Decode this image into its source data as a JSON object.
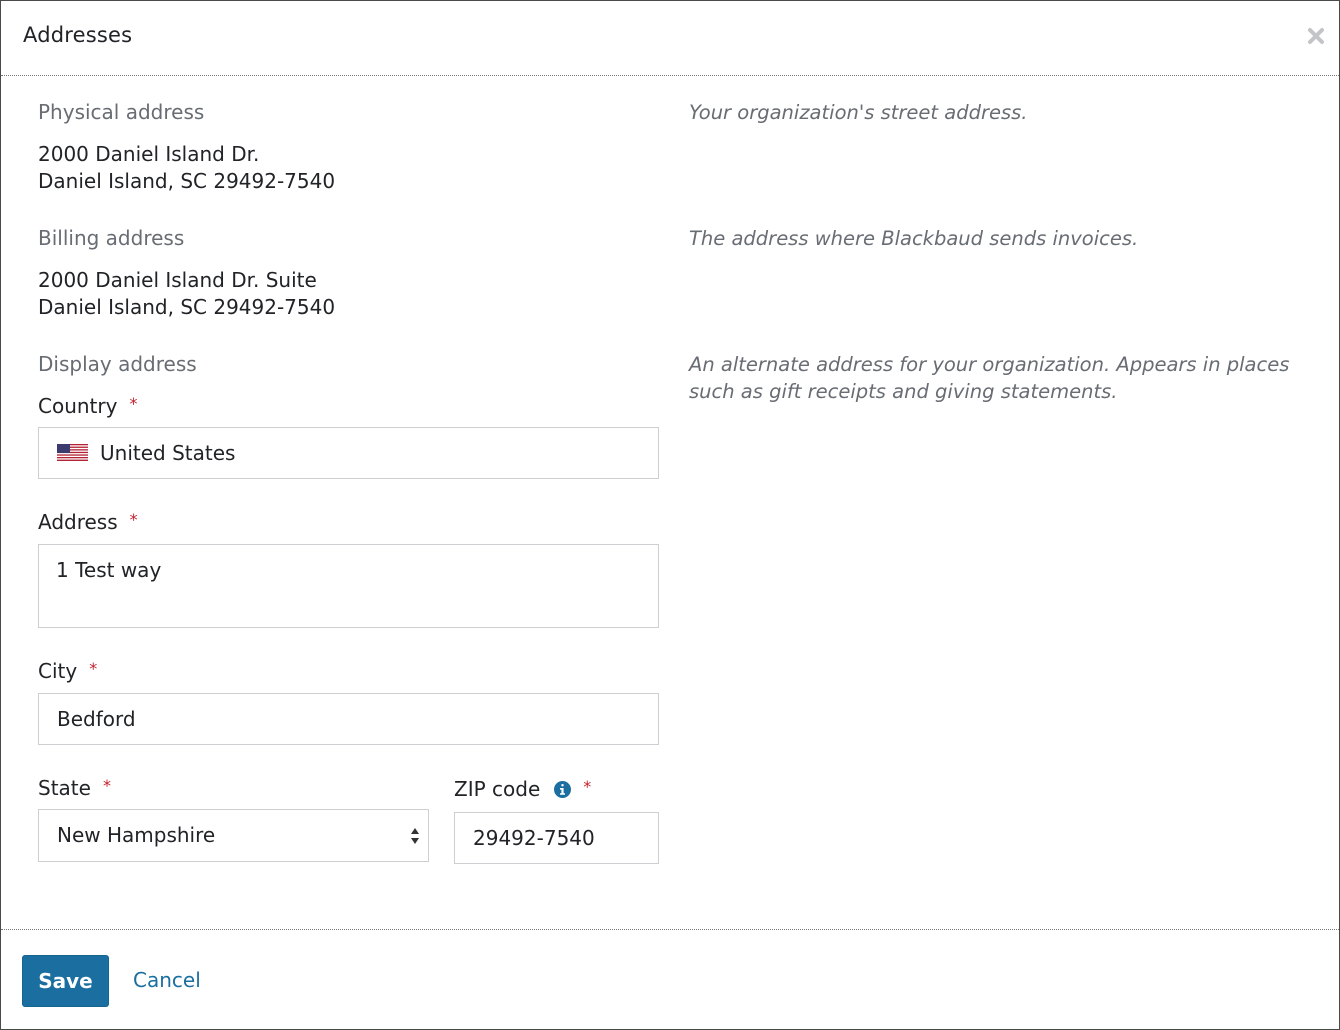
{
  "dialog": {
    "title": "Addresses"
  },
  "physical": {
    "label": "Physical address",
    "line1": "2000 Daniel Island Dr.",
    "line2": "Daniel Island, SC 29492-7540",
    "help": "Your organization's street address."
  },
  "billing": {
    "label": "Billing address",
    "line1": "2000 Daniel Island Dr. Suite",
    "line2": "Daniel Island, SC 29492-7540",
    "help": "The address where Blackbaud sends invoices."
  },
  "display": {
    "label": "Display address",
    "help": "An alternate address for your organization. Appears in places such as gift receipts and giving statements."
  },
  "form": {
    "required_mark": "*",
    "country": {
      "label": "Country",
      "value": "United States"
    },
    "address": {
      "label": "Address",
      "value": "1 Test way"
    },
    "city": {
      "label": "City",
      "value": "Bedford"
    },
    "state": {
      "label": "State",
      "value": "New Hampshire"
    },
    "zip": {
      "label": "ZIP code",
      "value": "29492-7540"
    }
  },
  "footer": {
    "save_label": "Save",
    "cancel_label": "Cancel"
  },
  "icons": {
    "close": "close-icon",
    "flag": "us-flag-icon",
    "info": "info-icon",
    "select_arrows": "select-arrows-icon"
  },
  "colors": {
    "primary": "#1b6fa0",
    "required": "#c4202f",
    "muted_text": "#686c73",
    "border": "#cdcfd2"
  }
}
